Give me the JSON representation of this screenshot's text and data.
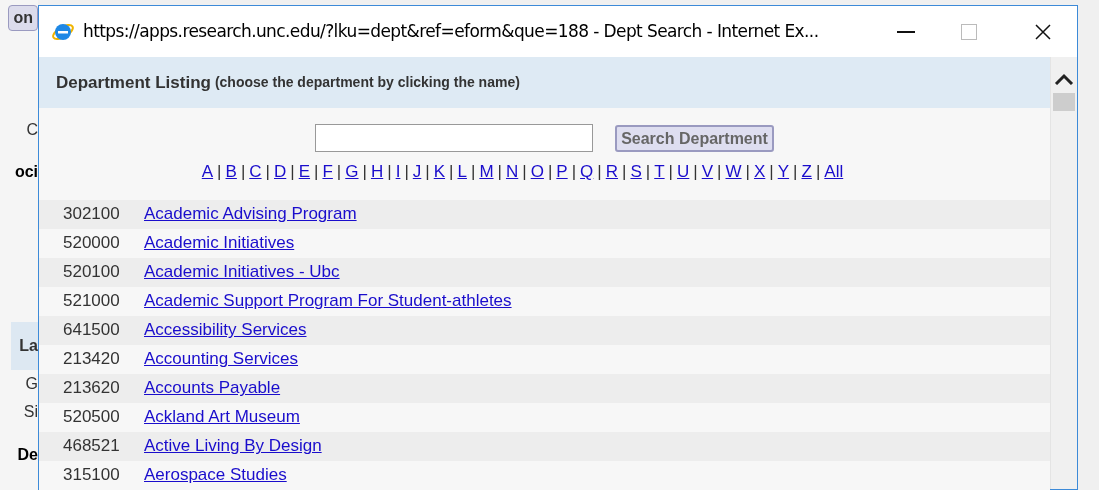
{
  "background_page": {
    "fragments": [
      {
        "kind": "button",
        "text": "on"
      },
      {
        "kind": "text",
        "text": "C"
      },
      {
        "kind": "bold",
        "text": "oci"
      },
      {
        "kind": "header",
        "text": "La"
      },
      {
        "kind": "text",
        "text": "G"
      },
      {
        "kind": "text",
        "text": "Si"
      },
      {
        "kind": "bold",
        "text": "De"
      }
    ]
  },
  "window": {
    "title": "https://apps.research.unc.edu/?lku=dept&ref=eform&que=188 - Dept Search - Internet Ex..."
  },
  "header": {
    "title": "Department Listing",
    "hint": "(choose the department by clicking the name)"
  },
  "search": {
    "button": "Search Department"
  },
  "letter_separator": "|",
  "letters": [
    "A",
    "B",
    "C",
    "D",
    "E",
    "F",
    "G",
    "H",
    "I",
    "J",
    "K",
    "L",
    "M",
    "N",
    "O",
    "P",
    "Q",
    "R",
    "S",
    "T",
    "U",
    "V",
    "W",
    "X",
    "Y",
    "Z",
    "All"
  ],
  "rows": [
    {
      "code": "302100",
      "name": "Academic Advising Program"
    },
    {
      "code": "520000",
      "name": "Academic Initiatives"
    },
    {
      "code": "520100",
      "name": "Academic Initiatives - Ubc"
    },
    {
      "code": "521000",
      "name": "Academic Support Program For Student-athletes"
    },
    {
      "code": "641500",
      "name": "Accessibility Services"
    },
    {
      "code": "213420",
      "name": "Accounting Services"
    },
    {
      "code": "213620",
      "name": "Accounts Payable"
    },
    {
      "code": "520500",
      "name": "Ackland Art Museum"
    },
    {
      "code": "468521",
      "name": "Active Living By Design"
    },
    {
      "code": "315100",
      "name": "Aerospace Studies"
    }
  ]
}
